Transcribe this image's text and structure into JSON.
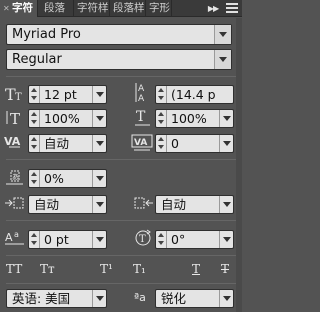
{
  "tabs": [
    {
      "label": "字符",
      "active": true
    },
    {
      "label": "段落",
      "active": false
    },
    {
      "label": "字符样",
      "active": false
    },
    {
      "label": "段落样",
      "active": false
    },
    {
      "label": "字形",
      "active": false
    }
  ],
  "font_family": "Myriad Pro",
  "font_style": "Regular",
  "font_size": "12 pt",
  "leading": "(14.4 p",
  "vertical_scale": "100%",
  "horizontal_scale": "100%",
  "kerning": "自动",
  "tracking": "0",
  "tsume": "0%",
  "aki_left": "自动",
  "aki_right": "自动",
  "baseline_shift": "0 pt",
  "rotation": "0°",
  "style_buttons": [
    "TT",
    "Tт",
    "T¹",
    "T₁",
    "T",
    "T"
  ],
  "language": "英语: 美国",
  "aa_label": "ªa",
  "antialias": "锐化"
}
